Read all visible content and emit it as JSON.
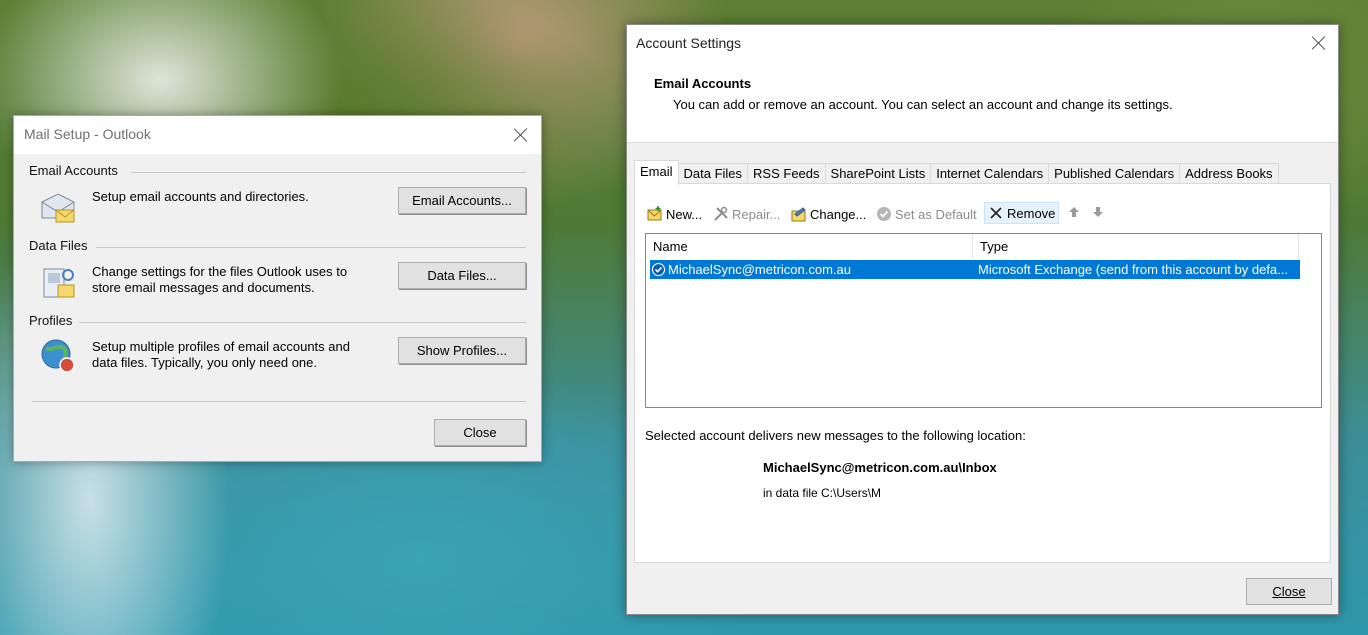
{
  "mail_setup": {
    "title": "Mail Setup - Outlook",
    "email_accounts": {
      "heading": "Email Accounts",
      "description": "Setup email accounts and directories.",
      "button": "Email Accounts..."
    },
    "data_files": {
      "heading": "Data Files",
      "description_line1": "Change settings for the files Outlook uses to",
      "description_line2": "store email messages and documents.",
      "button": "Data Files..."
    },
    "profiles": {
      "heading": "Profiles",
      "description_line1": "Setup multiple profiles of email accounts and",
      "description_line2": "data files. Typically, you only need one.",
      "button": "Show Profiles..."
    },
    "close_button": "Close"
  },
  "account_settings": {
    "title": "Account Settings",
    "heading": "Email Accounts",
    "subheading": "You can add or remove an account. You can select an account and change its settings.",
    "tabs": [
      {
        "label": "Email",
        "active": true
      },
      {
        "label": "Data Files"
      },
      {
        "label": "RSS Feeds"
      },
      {
        "label": "SharePoint Lists"
      },
      {
        "label": "Internet Calendars"
      },
      {
        "label": "Published Calendars"
      },
      {
        "label": "Address Books"
      }
    ],
    "toolbar": {
      "new": "New...",
      "repair": "Repair...",
      "change": "Change...",
      "set_default": "Set as Default",
      "remove": "Remove"
    },
    "table": {
      "columns": [
        "Name",
        "Type"
      ],
      "rows": [
        {
          "name": "MichaelSync@metricon.com.au",
          "type": "Microsoft Exchange (send from this account by defa...",
          "selected": true
        }
      ]
    },
    "delivery_label": "Selected account delivers new messages to the following location:",
    "delivery_path": "MichaelSync@metricon.com.au\\Inbox",
    "delivery_file": "in data file C:\\Users\\M",
    "close_button": "Close"
  },
  "colors": {
    "selection": "#0078d7",
    "dialog_bg": "#f0f0f0"
  }
}
